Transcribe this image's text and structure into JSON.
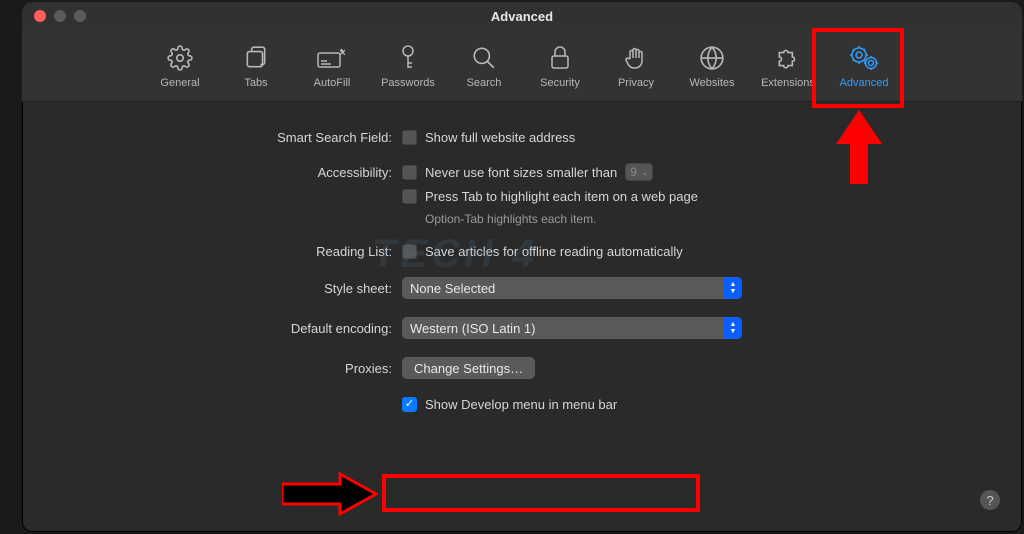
{
  "window": {
    "title": "Advanced"
  },
  "toolbar": {
    "general": "General",
    "tabs": "Tabs",
    "autofill": "AutoFill",
    "passwords": "Passwords",
    "search": "Search",
    "security": "Security",
    "privacy": "Privacy",
    "websites": "Websites",
    "extensions": "Extensions",
    "advanced": "Advanced"
  },
  "sections": {
    "smart_search_label": "Smart Search Field:",
    "smart_search_checkbox": "Show full website address",
    "accessibility_label": "Accessibility:",
    "accessibility_fontsize": "Never use font sizes smaller than",
    "accessibility_fontsize_value": "9",
    "accessibility_presstab": "Press Tab to highlight each item on a web page",
    "accessibility_hint": "Option-Tab highlights each item.",
    "reading_list_label": "Reading List:",
    "reading_list_checkbox": "Save articles for offline reading automatically",
    "style_sheet_label": "Style sheet:",
    "style_sheet_value": "None Selected",
    "default_encoding_label": "Default encoding:",
    "default_encoding_value": "Western (ISO Latin 1)",
    "proxies_label": "Proxies:",
    "proxies_button": "Change Settings…",
    "develop_menu": "Show Develop menu in menu bar"
  },
  "help": "?"
}
